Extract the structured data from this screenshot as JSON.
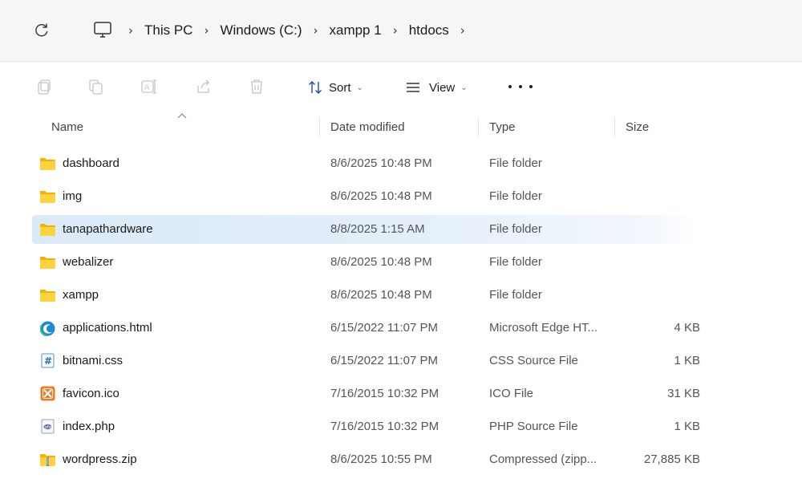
{
  "address_bar": {
    "breadcrumbs": [
      "This PC",
      "Windows (C:)",
      "xampp 1",
      "htdocs"
    ],
    "icons": [
      "refresh-icon",
      "computer-icon"
    ]
  },
  "command_bar": {
    "icons": [
      "new-icon",
      "copy-icon",
      "rename-icon",
      "share-icon",
      "delete-icon"
    ],
    "sort_label": "Sort",
    "view_label": "View",
    "more_label": "..."
  },
  "columns": {
    "name": "Name",
    "date": "Date modified",
    "type": "Type",
    "size": "Size"
  },
  "files": [
    {
      "name": "dashboard",
      "date": "8/6/2025 10:48 PM",
      "type": "File folder",
      "size": "",
      "icon": "folder-icon"
    },
    {
      "name": "img",
      "date": "8/6/2025 10:48 PM",
      "type": "File folder",
      "size": "",
      "icon": "folder-icon"
    },
    {
      "name": "tanapathardware",
      "date": "8/8/2025 1:15 AM",
      "type": "File folder",
      "size": "",
      "icon": "folder-icon",
      "selected": true
    },
    {
      "name": "webalizer",
      "date": "8/6/2025 10:48 PM",
      "type": "File folder",
      "size": "",
      "icon": "folder-icon"
    },
    {
      "name": "xampp",
      "date": "8/6/2025 10:48 PM",
      "type": "File folder",
      "size": "",
      "icon": "folder-icon"
    },
    {
      "name": "applications.html",
      "date": "6/15/2022 11:07 PM",
      "type": "Microsoft Edge HT...",
      "size": "4 KB",
      "icon": "edge-icon"
    },
    {
      "name": "bitnami.css",
      "date": "6/15/2022 11:07 PM",
      "type": "CSS Source File",
      "size": "1 KB",
      "icon": "css-file-icon"
    },
    {
      "name": "favicon.ico",
      "date": "7/16/2015 10:32 PM",
      "type": "ICO File",
      "size": "31 KB",
      "icon": "xampp-ico-icon"
    },
    {
      "name": "index.php",
      "date": "7/16/2015 10:32 PM",
      "type": "PHP Source File",
      "size": "1 KB",
      "icon": "php-file-icon"
    },
    {
      "name": "wordpress.zip",
      "date": "8/6/2025 10:55 PM",
      "type": "Compressed (zipp...",
      "size": "27,885 KB",
      "icon": "zip-folder-icon"
    }
  ]
}
